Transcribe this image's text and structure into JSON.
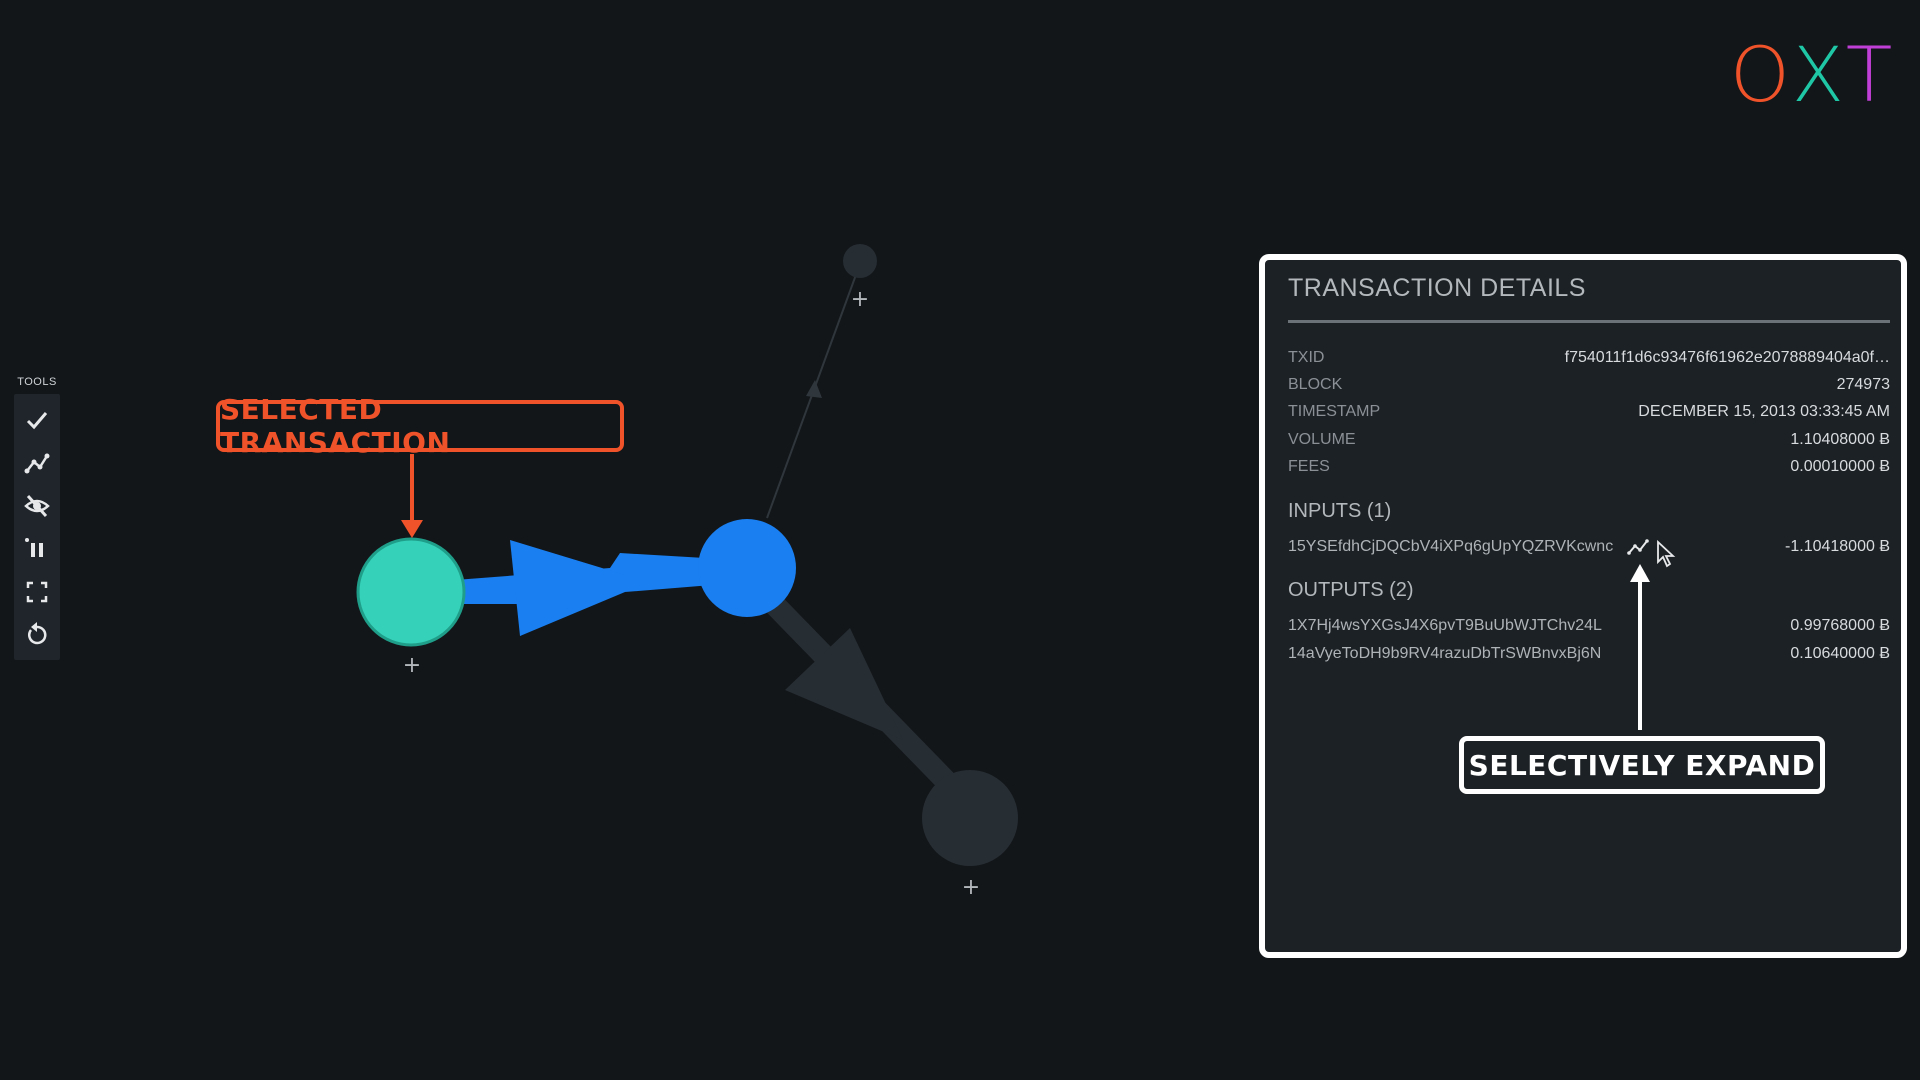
{
  "logo": {
    "letters": [
      "O",
      "X",
      "T"
    ]
  },
  "colors": {
    "background": "#121619",
    "selected_node": "#35d2b9",
    "active_node": "#1a7ff0",
    "inactive_node": "#262d33",
    "callout_orange": "#f0532a",
    "logo_o": "#f0532a",
    "logo_x": "#1fc7a6",
    "logo_t": "#c03fd6"
  },
  "tools": {
    "label": "TOOLS",
    "buttons": [
      {
        "name": "check-icon"
      },
      {
        "name": "expand-graph-icon"
      },
      {
        "name": "hide-icon"
      },
      {
        "name": "pause-icon"
      },
      {
        "name": "fullscreen-icon"
      },
      {
        "name": "reset-icon"
      }
    ]
  },
  "graph": {
    "expand_glyph": "+"
  },
  "callouts": {
    "selected": "SELECTED TRANSACTION",
    "expand": "SELECTIVELY EXPAND"
  },
  "panel": {
    "title": "TRANSACTION DETAILS",
    "fields": [
      {
        "key": "TXID",
        "value": "f754011f1d6c93476f61962e2078889404a0f…"
      },
      {
        "key": "BLOCK",
        "value": "274973"
      },
      {
        "key": "TIMESTAMP",
        "value": "DECEMBER 15, 2013 03:33:45 AM"
      },
      {
        "key": "VOLUME",
        "value": "1.10408000 Ƀ"
      },
      {
        "key": "FEES",
        "value": "0.00010000 Ƀ"
      }
    ],
    "inputs_label": "INPUTS (1)",
    "inputs": [
      {
        "address": "15YSEfdhCjDQCbV4iXPq6gUpYQZRVKcwnc",
        "amount": "-1.10418000 Ƀ"
      }
    ],
    "outputs_label": "OUTPUTS (2)",
    "outputs": [
      {
        "address": "1X7Hj4wsYXGsJ4X6pvT9BuUbWJTChv24L",
        "amount": "0.99768000 Ƀ"
      },
      {
        "address": "14aVyeToDH9b9RV4razuDbTrSWBnvxBj6N",
        "amount": "0.10640000 Ƀ"
      }
    ]
  }
}
